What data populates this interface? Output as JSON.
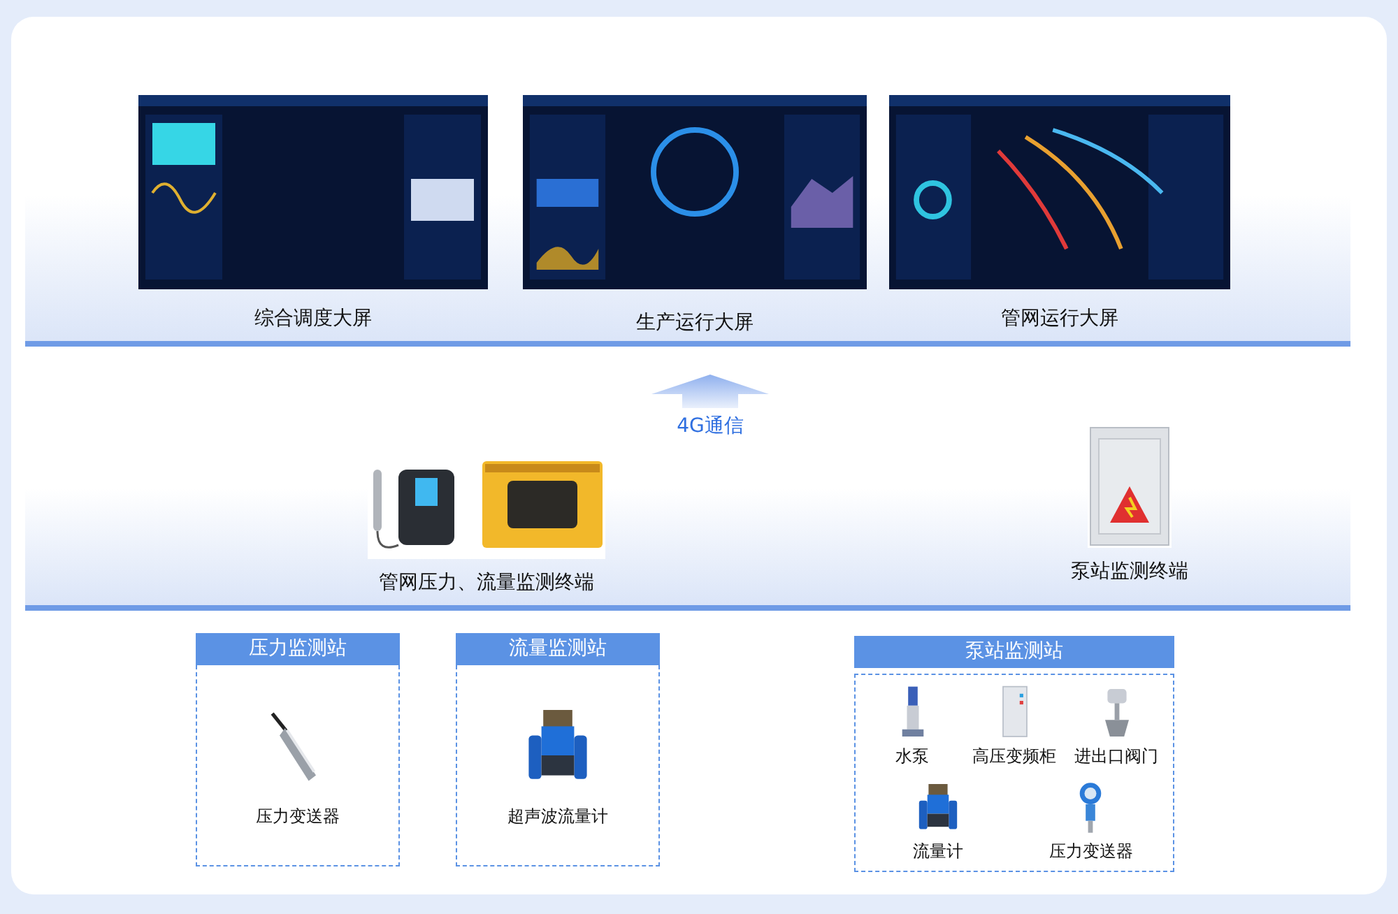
{
  "screens": [
    {
      "label": "综合调度大屏",
      "kind": "picture"
    },
    {
      "label": "生产运行大屏",
      "kind": "picture"
    },
    {
      "label": "管网运行大屏",
      "kind": "picture"
    }
  ],
  "link": {
    "label": "4G通信"
  },
  "terminals": [
    {
      "label": "管网压力、流量监测终端",
      "kind": "picture"
    },
    {
      "label": "泵站监测终端",
      "kind": "picture"
    }
  ],
  "stations": [
    {
      "title": "压力监测站",
      "items": [
        {
          "label": "压力变送器",
          "kind": "sensor"
        }
      ]
    },
    {
      "title": "流量监测站",
      "items": [
        {
          "label": "超声波流量计",
          "kind": "flowmeter"
        }
      ]
    },
    {
      "title": "泵站监测站",
      "items": [
        {
          "label": "水泵",
          "kind": "pump"
        },
        {
          "label": "高压变频柜",
          "kind": "cabinet"
        },
        {
          "label": "进出口阀门",
          "kind": "valve"
        },
        {
          "label": "流量计",
          "kind": "flowmeter"
        },
        {
          "label": "压力变送器",
          "kind": "transmitter"
        }
      ]
    }
  ]
}
